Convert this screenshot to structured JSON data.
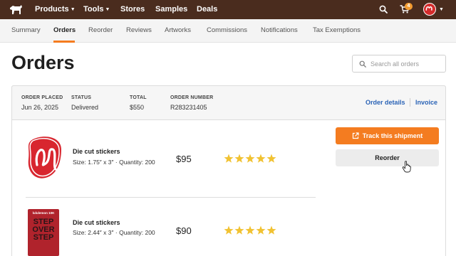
{
  "topnav": {
    "logo_icon": "horse-icon",
    "items": [
      {
        "label": "Products",
        "has_caret": true
      },
      {
        "label": "Tools",
        "has_caret": true
      },
      {
        "label": "Stores",
        "has_caret": false
      },
      {
        "label": "Samples",
        "has_caret": false
      },
      {
        "label": "Deals",
        "has_caret": false
      }
    ],
    "cart_count": "4",
    "colors": {
      "background": "#4a2c1e",
      "badge": "#f39c32",
      "avatar": "#d42b2b"
    }
  },
  "subnav": {
    "tabs": [
      "Summary",
      "Orders",
      "Reorder",
      "Reviews",
      "Artworks",
      "Commissions",
      "Notifications",
      "Tax Exemptions"
    ],
    "active_tab": "Orders",
    "accent": "#f47c20"
  },
  "page": {
    "title": "Orders",
    "search_placeholder": "Search all orders"
  },
  "order": {
    "placed_label": "ORDER PLACED",
    "placed_value": "Jun 26, 2025",
    "status_label": "STATUS",
    "status_value": "Delivered",
    "total_label": "TOTAL",
    "total_value": "$550",
    "number_label": "ORDER NUMBER",
    "number_value": "R283231405",
    "details_link": "Order details",
    "invoice_link": "Invoice",
    "track_button": "Track this shipment",
    "reorder_button": "Reorder",
    "items": [
      {
        "name": "Die cut stickers",
        "size": "Size: 1.75″ x 3″",
        "quantity": "Quantity: 200",
        "price": "$95",
        "rating": 5
      },
      {
        "name": "Die cut stickers",
        "size": "Size: 2.44″ x 3″",
        "quantity": "Quantity: 200",
        "price": "$90",
        "rating": 5
      }
    ],
    "thumb2_text": {
      "brand": "lululemon 10K",
      "lines": [
        "STEP",
        "OVER",
        "STEP"
      ]
    }
  }
}
